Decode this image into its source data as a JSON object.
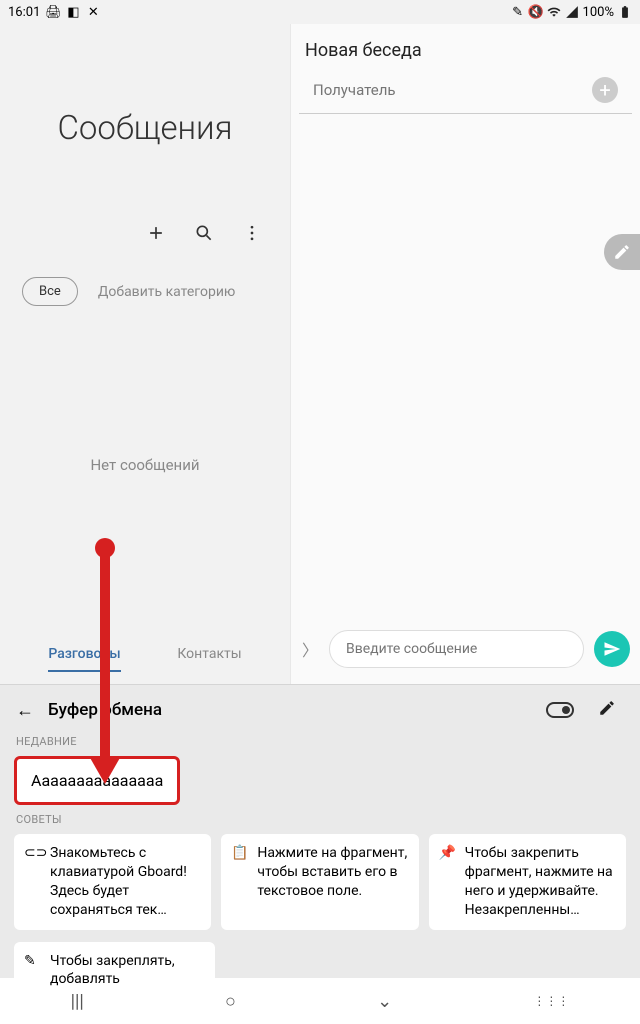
{
  "status": {
    "time": "16:01",
    "battery": "100%"
  },
  "left": {
    "title": "Сообщения",
    "chip": "Все",
    "add_category": "Добавить категорию",
    "empty": "Нет сообщений",
    "tabs": {
      "conversations": "Разговоры",
      "contacts": "Контакты"
    }
  },
  "right": {
    "title": "Новая беседа",
    "recipient_ph": "Получатель",
    "compose_ph": "Введите сообщение"
  },
  "clipboard": {
    "title": "Буфер обмена",
    "section_recent": "НЕДАВНИЕ",
    "recent_item": "Ааааааааааааааа",
    "section_tips": "СОВЕТЫ",
    "tips": [
      {
        "icon": "gboard",
        "text": "Знакомьтесь с клавиатурой Gboard!\nЗдесь будет сохраняться тек…"
      },
      {
        "icon": "clipboard",
        "text": "Нажмите на фрагмент, чтобы вставить его в текстовое поле."
      },
      {
        "icon": "pin",
        "text": "Чтобы закрепить фрагмент, нажмите на него и удерживайте. Незакрепленны…"
      },
      {
        "icon": "pencil",
        "text": "Чтобы закреплять, добавлять"
      }
    ]
  }
}
